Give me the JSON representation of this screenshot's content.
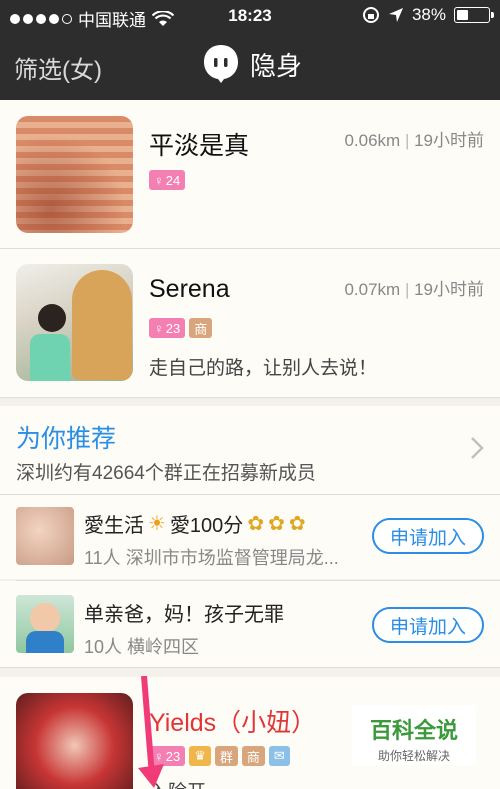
{
  "status_bar": {
    "carrier": "中国联通",
    "time": "18:23",
    "battery_percent": "38%",
    "battery_level": 0.38
  },
  "nav": {
    "filter_label": "筛选(女)",
    "stealth_label": "隐身"
  },
  "users": [
    {
      "name": "平淡是真",
      "distance": "0.06km",
      "time_ago": "19小时前",
      "age": "24",
      "signature": ""
    },
    {
      "name": "Serena",
      "distance": "0.07km",
      "time_ago": "19小时前",
      "age": "23",
      "badge_biz": "商",
      "signature": "走自己的路，让别人去说！"
    }
  ],
  "recommend": {
    "title": "为你推荐",
    "subtitle": "深圳约有42664个群正在招募新成员"
  },
  "groups": [
    {
      "name": "愛生活",
      "name_mid": "愛100分",
      "members": "11人",
      "location": "深圳市市场监督管理局龙...",
      "join_label": "申请加入"
    },
    {
      "name": "单亲爸，妈！孩子无罪",
      "members": "10人",
      "location": "横岭四区",
      "join_label": "申请加入"
    }
  ],
  "bottom_user": {
    "name": "Yields（小妞）",
    "age": "23",
    "badge_group": "群",
    "badge_biz": "商",
    "signature_partial": "入除开"
  },
  "watermark": {
    "title": "百科全说",
    "subtitle": "助你轻松解决"
  },
  "colors": {
    "accent": "#2a8ee6",
    "nav_bg": "#2d2d2d",
    "female_tag": "#f47fb3",
    "red_name": "#e23636"
  }
}
